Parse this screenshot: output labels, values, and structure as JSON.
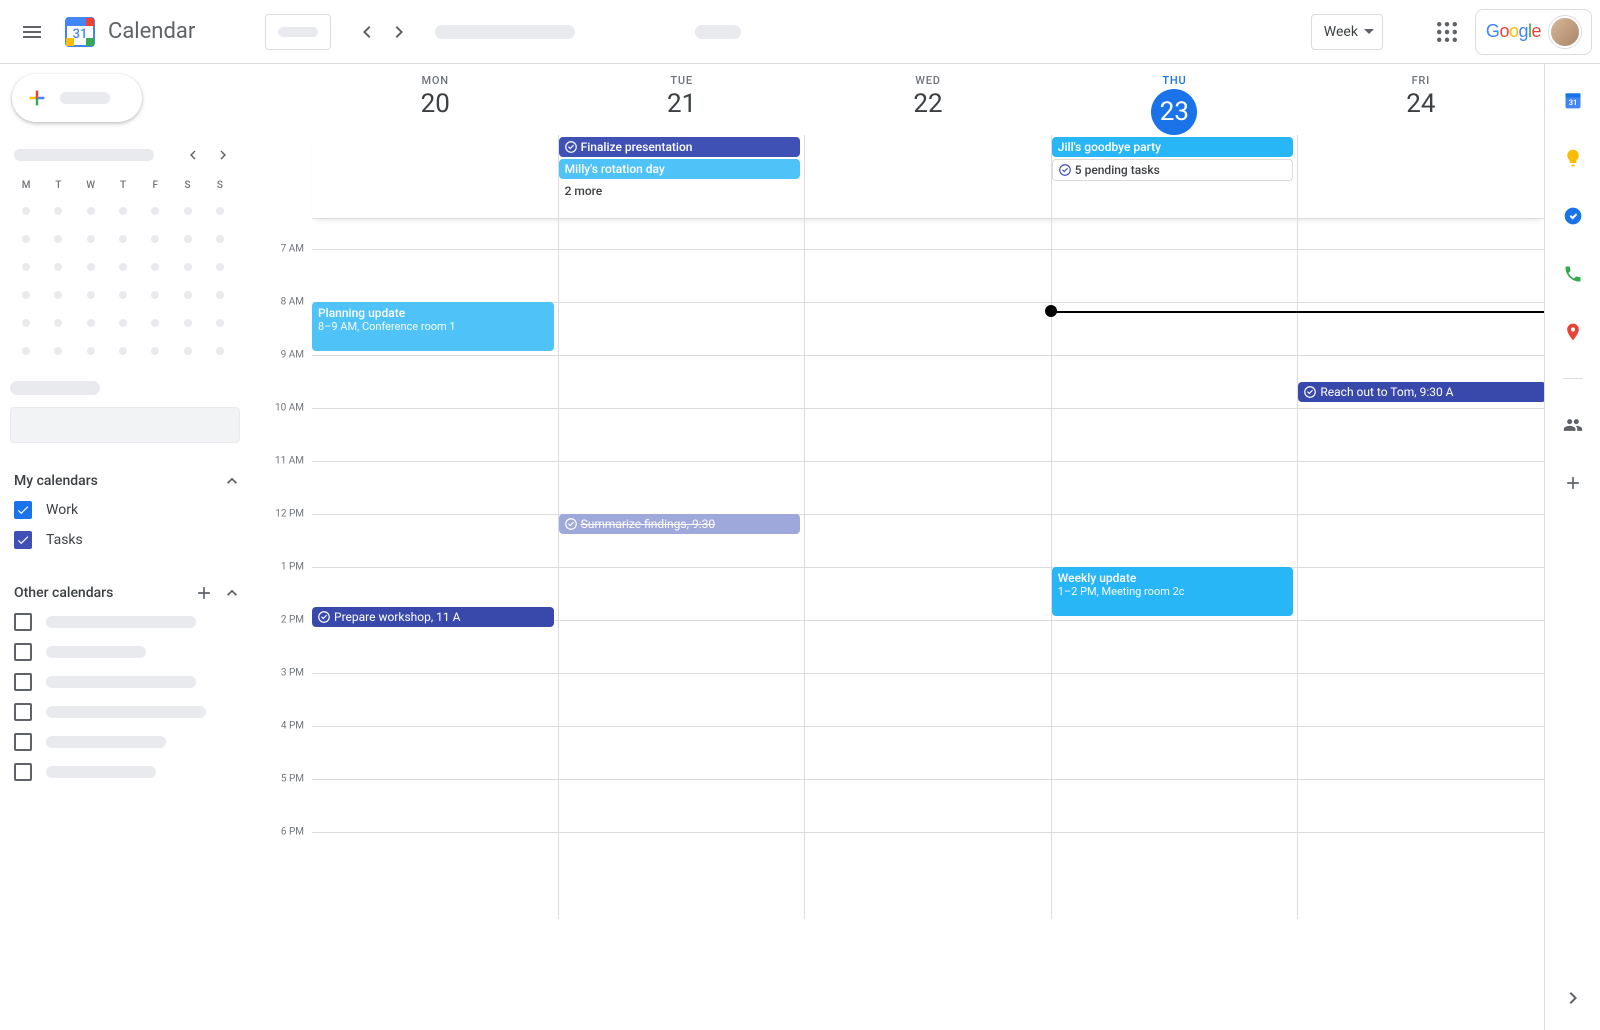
{
  "header": {
    "app_title": "Calendar",
    "view_label": "Week"
  },
  "sidebar": {
    "mini_dow": [
      "M",
      "T",
      "W",
      "T",
      "F",
      "S",
      "S"
    ],
    "my_calendars_title": "My calendars",
    "other_calendars_title": "Other calendars",
    "cal_work": "Work",
    "cal_tasks": "Tasks",
    "other_widths": [
      150,
      100,
      150,
      160,
      120,
      110
    ]
  },
  "days": [
    {
      "dow": "MON",
      "num": "20",
      "today": false
    },
    {
      "dow": "TUE",
      "num": "21",
      "today": false
    },
    {
      "dow": "WED",
      "num": "22",
      "today": false
    },
    {
      "dow": "THU",
      "num": "23",
      "today": true
    },
    {
      "dow": "FRI",
      "num": "24",
      "today": false
    }
  ],
  "allday": {
    "tue": {
      "finalize": "Finalize presentation",
      "rotation": "Milly's rotation day",
      "more": "2 more"
    },
    "thu": {
      "party": "Jill's goodbye party",
      "pending": "5 pending tasks"
    }
  },
  "hours": [
    "7 AM",
    "8 AM",
    "9 AM",
    "10 AM",
    "11 AM",
    "12 PM",
    "1 PM",
    "2 PM",
    "3 PM",
    "4 PM",
    "5 PM",
    "6 PM"
  ],
  "events": {
    "planning_title": "Planning update",
    "planning_sub": "8–9 AM, Conference room 1",
    "summarize_text": "Summarize findings, 9:30",
    "workshop_text": "Prepare workshop, 11 A",
    "weekly_title": "Weekly update",
    "weekly_sub": "1–2 PM, Meeting room 2c",
    "reach_text": "Reach out to Tom, 9:30 A"
  },
  "colors": {
    "indigo": "#3f51b5",
    "lightblue": "#4fc3f7",
    "skyblue": "#29b6f6",
    "lavender": "#9fa8da",
    "deepindigo": "#3949ab"
  }
}
